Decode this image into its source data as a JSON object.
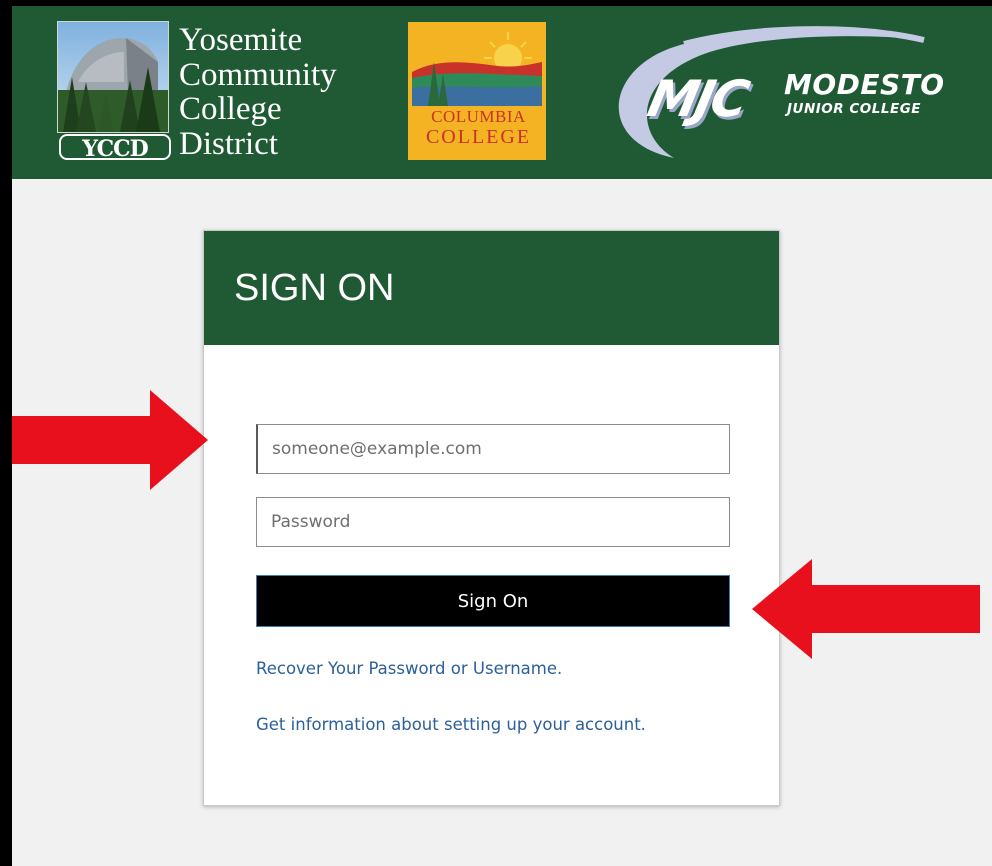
{
  "header": {
    "yccd": {
      "name_lines": [
        "Yosemite",
        "Community",
        "College",
        "District"
      ],
      "abbreviation": "YCCD"
    },
    "columbia": {
      "line1": "COLUMBIA",
      "line2": "COLLEGE"
    },
    "mjc": {
      "letters": "MJC",
      "name": "MODESTO",
      "subname": "JUNIOR COLLEGE"
    }
  },
  "signon": {
    "title": "SIGN ON",
    "email_placeholder": "someone@example.com",
    "email_value": "",
    "password_placeholder": "Password",
    "password_value": "",
    "button_label": "Sign On",
    "recover_link": "Recover Your Password or Username.",
    "info_link": "Get information about setting up your account."
  },
  "colors": {
    "brand_green": "#1f5a34",
    "arrow_red": "#e8101c",
    "link_blue": "#2b5f9a",
    "columbia_gold": "#f4b322"
  },
  "annotations": {
    "arrows": [
      "arrow-pointing-right",
      "arrow-pointing-left"
    ]
  }
}
